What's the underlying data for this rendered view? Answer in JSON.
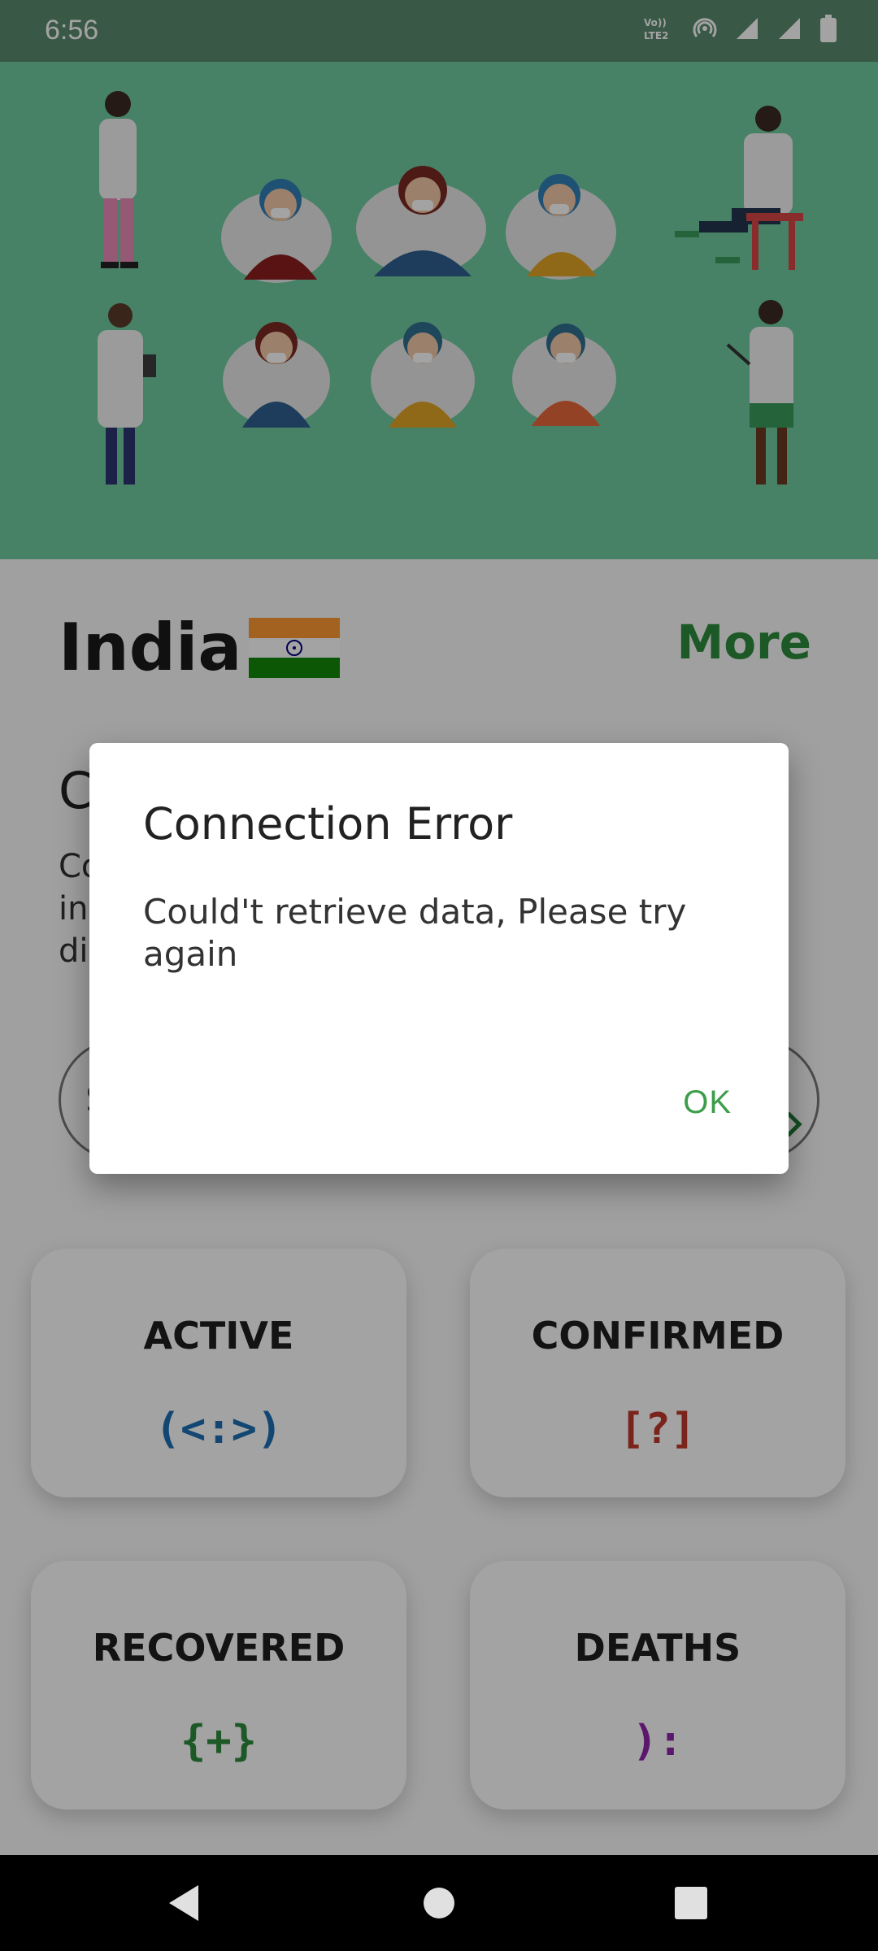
{
  "status_bar": {
    "time": "6:56",
    "icons": [
      "volte-icon",
      "hotspot-icon",
      "signal-icon",
      "signal-icon",
      "battery-icon"
    ],
    "volte_text": "Vo)) LTE2"
  },
  "country": {
    "name": "India",
    "more_label": "More"
  },
  "background_text": {
    "heading_partial": "C",
    "para_lines": [
      "Co",
      "in",
      "di"
    ],
    "pill_partial": "S"
  },
  "stats": {
    "active": {
      "label": "ACTIVE",
      "value": "(<:>)",
      "color": "#1f6fb5"
    },
    "confirmed": {
      "label": "CONFIRMED",
      "value": "[?]",
      "color": "#c0392b"
    },
    "recovered": {
      "label": "RECOVERED",
      "value": "{+}",
      "color": "#2e8b3e"
    },
    "deaths": {
      "label": "DEATHS",
      "value": "):",
      "color": "#8e24aa"
    }
  },
  "dialog": {
    "title": "Connection Error",
    "message": "Could't retrieve data, Please try again",
    "ok_label": "OK"
  },
  "colors": {
    "hero_bg": "#6fcaa0",
    "accent_green": "#2e8b3e",
    "status_bar": "#5a8a6e"
  },
  "nav": {
    "icons": [
      "back-icon",
      "home-icon",
      "recents-icon"
    ]
  }
}
